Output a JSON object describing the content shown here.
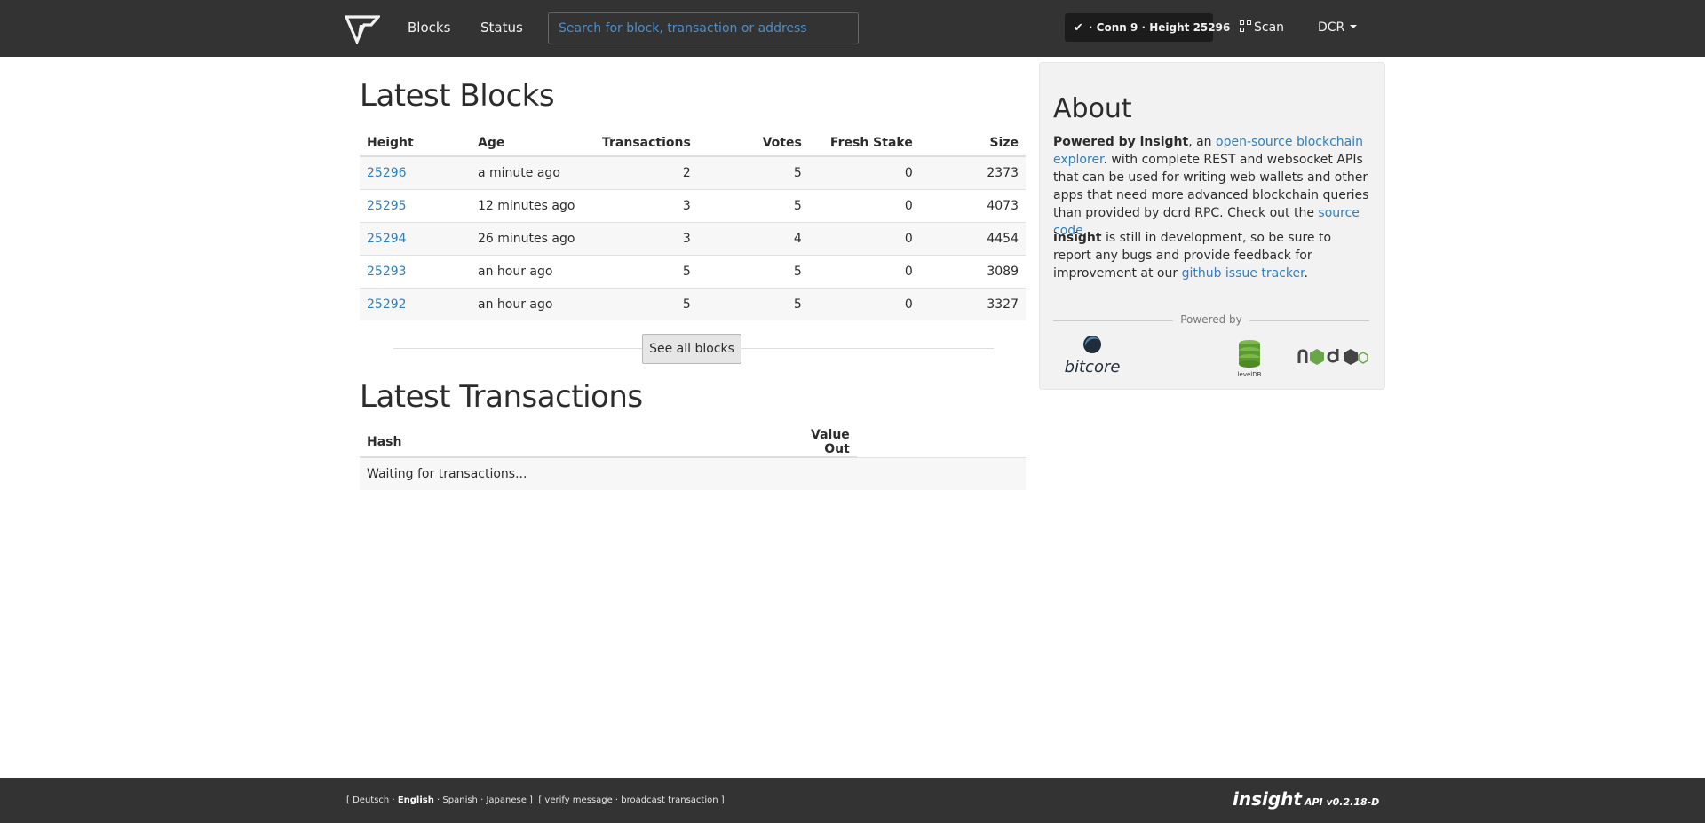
{
  "nav": {
    "links": [
      "Blocks",
      "Status"
    ],
    "search_placeholder": "Search for block, transaction or address",
    "conn_status": "· Conn 9 · Height 25296",
    "scan_label": "Scan",
    "currency": "DCR"
  },
  "blocks": {
    "title": "Latest Blocks",
    "columns": [
      "Height",
      "Age",
      "Transactions",
      "Votes",
      "Fresh Stake",
      "Size"
    ],
    "rows": [
      [
        "25296",
        "a minute ago",
        "2",
        "5",
        "0",
        "2373"
      ],
      [
        "25295",
        "12 minutes ago",
        "3",
        "5",
        "0",
        "4073"
      ],
      [
        "25294",
        "26 minutes ago",
        "3",
        "4",
        "0",
        "4454"
      ],
      [
        "25293",
        "an hour ago",
        "5",
        "5",
        "0",
        "3089"
      ],
      [
        "25292",
        "an hour ago",
        "5",
        "5",
        "0",
        "3327"
      ]
    ],
    "see_all_label": "See all blocks"
  },
  "transactions": {
    "title": "Latest Transactions",
    "columns": [
      "Hash",
      "Value Out"
    ],
    "waiting_text": "Waiting for transactions..."
  },
  "about": {
    "title": "About",
    "p1_bold": "Powered by insight",
    "p1_a": ", an ",
    "p1_link": "open-source blockchain explorer",
    "p1_b": ". with complete REST and websocket APIs that can be used for writing web wallets and other apps that need more advanced blockchain queries than provided by dcrd RPC. Check out the ",
    "p1_link2": "source code",
    "p1_c": ".",
    "p2_bold": "insight",
    "p2_a": " is still in development, so be sure to report any bugs and provide feedback for improvement at our ",
    "p2_link": "github issue tracker",
    "p2_b": ".",
    "powered_by": "Powered by",
    "logos": {
      "bitcore": "bitcore",
      "leveldb": "levelDB"
    }
  },
  "footer": {
    "lang_open": "[ ",
    "lang": [
      "Deutsch",
      "English",
      "Spanish",
      "Japanese"
    ],
    "lang_close": " ]",
    "tools_open": "[ ",
    "tools": [
      "verify message",
      "broadcast transaction"
    ],
    "tools_close": " ]",
    "brand": "insight",
    "version": "API v0.2.18-D"
  },
  "colors": {
    "navbar": "#333333",
    "link": "#2f7fc1",
    "panel": "#f2f2f2"
  }
}
